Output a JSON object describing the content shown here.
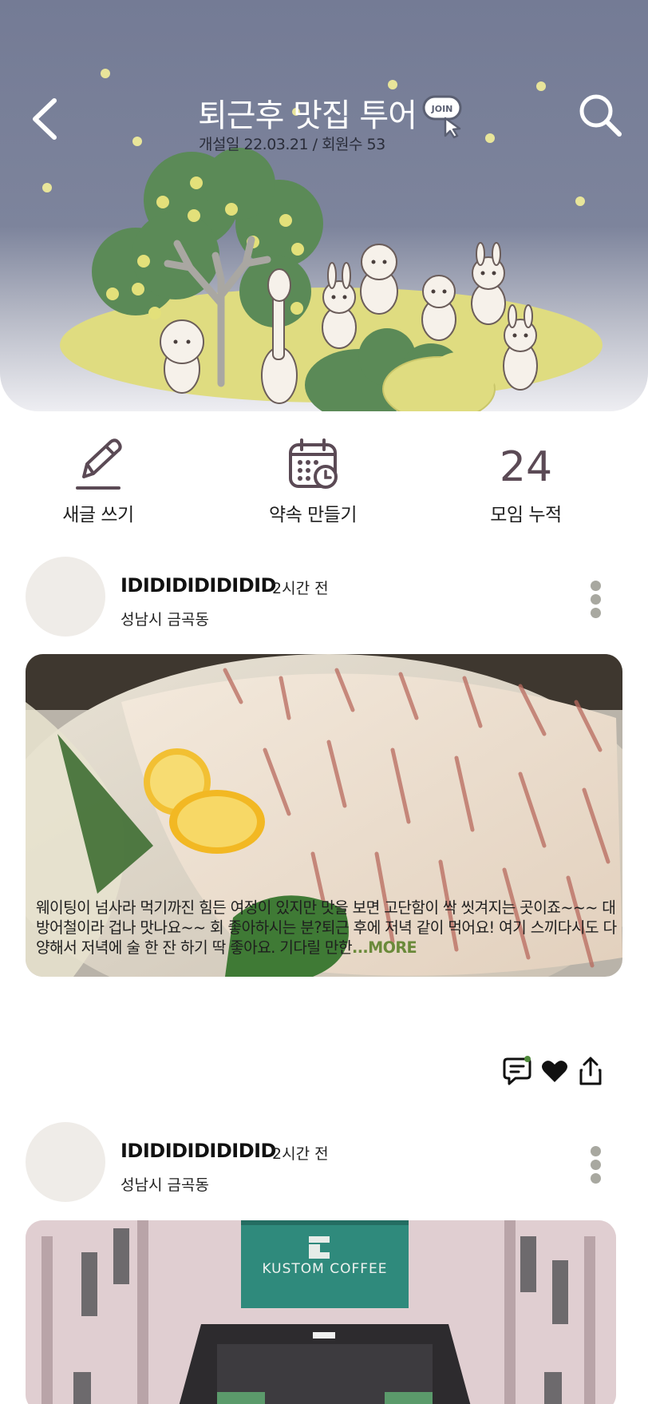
{
  "header": {
    "title": "퇴근후 맛집 투어",
    "meta": "개설일 22.03.21 / 회원수 53",
    "join_badge": "JOIN",
    "back_icon": "chevron-left-icon",
    "search_icon": "search-icon"
  },
  "actions": {
    "write_label": "새글 쓰기",
    "appointment_label": "약속 만들기",
    "meetings_count": "24",
    "meetings_label": "모임 누적"
  },
  "posts": [
    {
      "author": "IDIDIDIDIDIDID",
      "time": "2시간 전",
      "location": "성남시 금곡동",
      "image": "sashimi-photo",
      "text": "웨이팅이 넘사라 먹기까진 힘든 여정이 있지만 맛을 보면 고단함이 싹 씻겨지는 곳이죠~~~ 대방어철이라 겁나 맛나요~~ 회 좋아하시는 분?퇴근 후에 저녁 같이 먹어요! 여기 스끼다시도 다양해서 저녁에 술 한 잔 하기 딱 좋아요. 기다릴 만한",
      "more_label": "...MORE"
    },
    {
      "author": "IDIDIDIDIDIDID",
      "time": "2시간 전",
      "location": "성남시 금곡동",
      "image": "cafe-photo",
      "sign_text": "KUSTOM COFFEE"
    }
  ],
  "colors": {
    "header_bg": "#747b95",
    "accent_green": "#6a8a3a",
    "meadow": "#dfdc80",
    "tree_green": "#5b8a57",
    "count_color": "#5b4a55"
  }
}
